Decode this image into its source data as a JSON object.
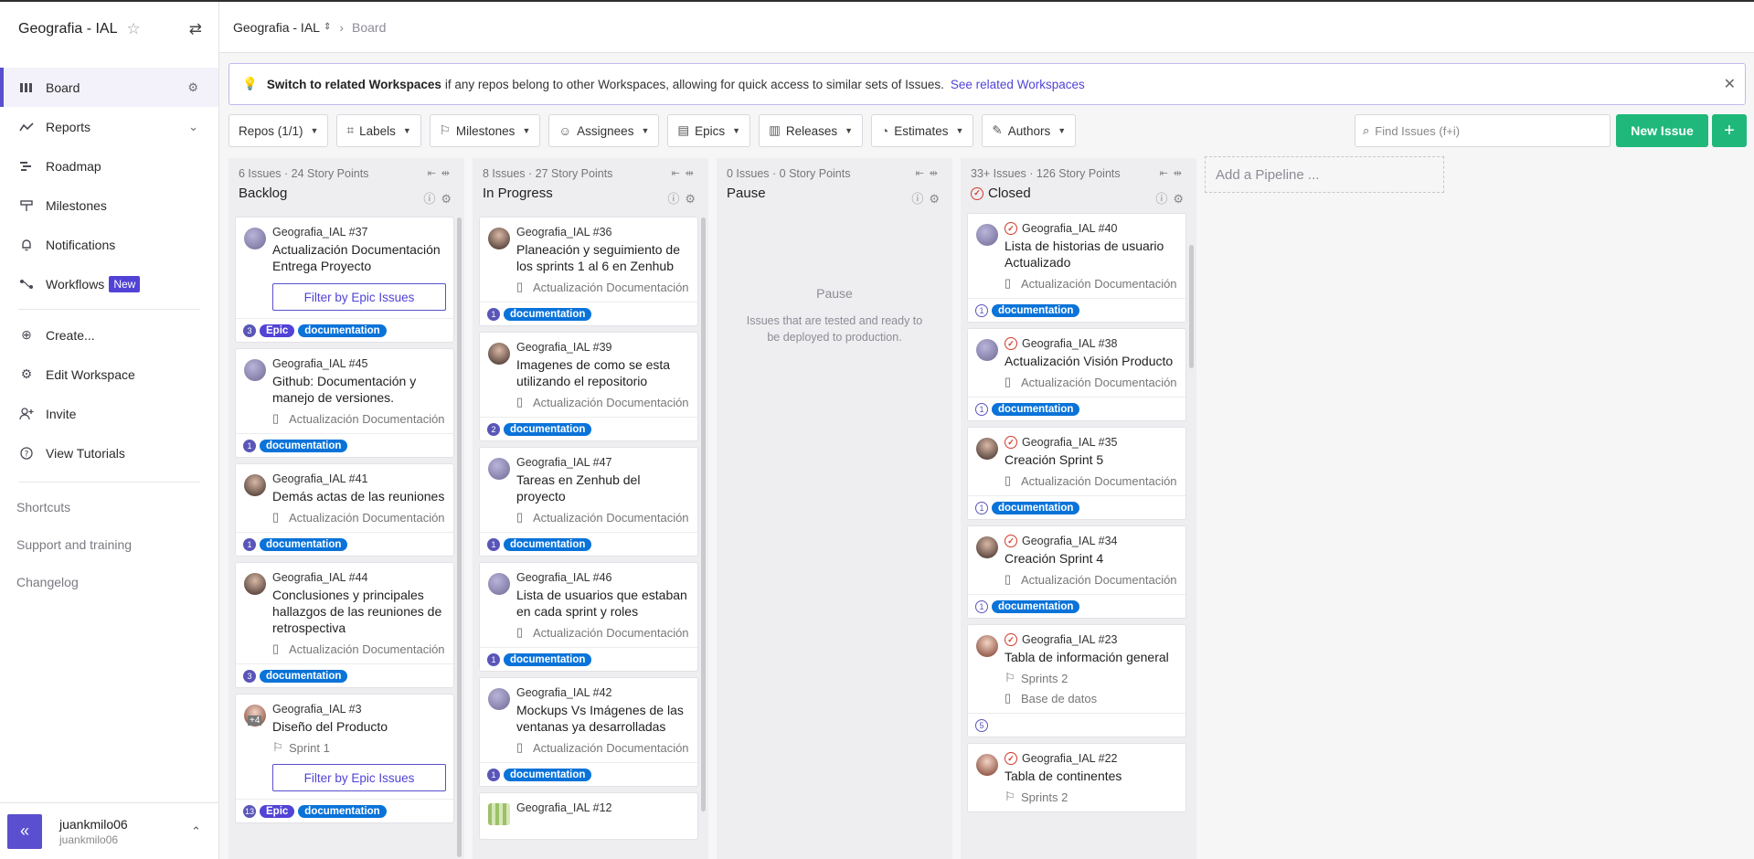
{
  "sidebar": {
    "workspace": "Geografia - IAL",
    "nav": [
      {
        "label": "Board",
        "icon": "board-icon"
      },
      {
        "label": "Reports",
        "icon": "reports-icon"
      },
      {
        "label": "Roadmap",
        "icon": "roadmap-icon"
      },
      {
        "label": "Milestones",
        "icon": "milestone-icon"
      },
      {
        "label": "Notifications",
        "icon": "bell-icon"
      },
      {
        "label": "Workflows",
        "icon": "workflow-icon",
        "badge": "New"
      }
    ],
    "actions": [
      "Create...",
      "Edit Workspace",
      "Invite",
      "View Tutorials"
    ],
    "minor": [
      "Shortcuts",
      "Support and training",
      "Changelog"
    ],
    "user": {
      "name": "juankmilo06",
      "handle": "juankmilo06"
    }
  },
  "header": {
    "workspace": "Geografia - IAL",
    "page": "Board"
  },
  "banner": {
    "lead": "Switch to related Workspaces",
    "text": "if any repos belong to other Workspaces, allowing for quick access to similar sets of Issues.",
    "link": "See related Workspaces"
  },
  "toolbar": {
    "repos": "Repos (1/1)",
    "labels": "Labels",
    "milestones": "Milestones",
    "assignees": "Assignees",
    "epics": "Epics",
    "releases": "Releases",
    "estimates": "Estimates",
    "authors": "Authors",
    "search_placeholder": "Find Issues (f+i)",
    "new_issue": "New Issue",
    "add": "+"
  },
  "pipelines": [
    {
      "name": "Backlog",
      "meta": "6 Issues · 24 Story Points",
      "cards": [
        {
          "repo": "Geografia_IAL #37",
          "title": "Actualización Documentación Entrega Proyecto",
          "filter": "Filter by Epic Issues",
          "est": "3",
          "labels": [
            "Epic",
            "documentation"
          ]
        },
        {
          "repo": "Geografia_IAL #45",
          "title": "Github: Documentación y manejo de versiones.",
          "epic": "Actualización Documentación Ent...",
          "est": "1",
          "labels": [
            "documentation"
          ]
        },
        {
          "repo": "Geografia_IAL #41",
          "title": "Demás actas de las reuniones",
          "epic": "Actualización Documentación Ent...",
          "est": "1",
          "labels": [
            "documentation"
          ]
        },
        {
          "repo": "Geografia_IAL #44",
          "title": "Conclusiones y principales hallazgos de las reuniones de retrospectiva",
          "epic": "Actualización Documentación Ent...",
          "est": "3",
          "labels": [
            "documentation"
          ]
        },
        {
          "repo": "Geografia_IAL #3",
          "title": "Diseño del Producto",
          "milestone": "Sprint 1",
          "filter": "Filter by Epic Issues",
          "avatar_more": "+4",
          "est": "13",
          "labels": [
            "Epic",
            "documentation"
          ]
        }
      ]
    },
    {
      "name": "In Progress",
      "meta": "8 Issues · 27 Story Points",
      "cards": [
        {
          "repo": "Geografia_IAL #36",
          "title": "Planeación y seguimiento de los sprints 1 al 6 en Zenhub",
          "epic": "Actualización Documentación Ent...",
          "est": "1",
          "labels": [
            "documentation"
          ]
        },
        {
          "repo": "Geografia_IAL #39",
          "title": "Imagenes de como se esta utilizando el repositorio",
          "epic": "Actualización Documentación Ent...",
          "est": "2",
          "labels": [
            "documentation"
          ]
        },
        {
          "repo": "Geografia_IAL #47",
          "title": "Tareas en Zenhub del proyecto",
          "epic": "Actualización Documentación Ent...",
          "est": "1",
          "labels": [
            "documentation"
          ]
        },
        {
          "repo": "Geografia_IAL #46",
          "title": "Lista de usuarios que estaban en cada sprint y roles",
          "epic": "Actualización Documentación Ent...",
          "est": "1",
          "labels": [
            "documentation"
          ]
        },
        {
          "repo": "Geografia_IAL #42",
          "title": "Mockups Vs Imágenes de las ventanas ya desarrolladas",
          "epic": "Actualización Documentación Ent...",
          "est": "1",
          "labels": [
            "documentation"
          ]
        },
        {
          "repo": "Geografia_IAL #12",
          "title": ""
        }
      ]
    },
    {
      "name": "Pause",
      "meta": "0 Issues · 0 Story Points",
      "empty_title": "Pause",
      "empty_text": "Issues that are tested and ready to be deployed to production."
    },
    {
      "name": "Closed",
      "meta": "33+ Issues · 126 Story Points",
      "cards": [
        {
          "repo": "Geografia_IAL #40",
          "title": "Lista de historias de usuario Actualizado",
          "epic": "Actualización Documentación Ent...",
          "est": "1",
          "labels": [
            "documentation"
          ]
        },
        {
          "repo": "Geografia_IAL #38",
          "title": "Actualización Visión Producto",
          "epic": "Actualización Documentación Ent...",
          "est": "1",
          "labels": [
            "documentation"
          ]
        },
        {
          "repo": "Geografia_IAL #35",
          "title": "Creación Sprint 5",
          "epic": "Actualización Documentación Ent...",
          "est": "1",
          "labels": [
            "documentation"
          ]
        },
        {
          "repo": "Geografia_IAL #34",
          "title": "Creación Sprint 4",
          "epic": "Actualización Documentación Ent...",
          "est": "1",
          "labels": [
            "documentation"
          ]
        },
        {
          "repo": "Geografia_IAL #23",
          "title": "Tabla de información general",
          "milestone": "Sprints 2",
          "epic": "Base de datos",
          "est": "5"
        },
        {
          "repo": "Geografia_IAL #22",
          "title": "Tabla de continentes",
          "milestone": "Sprints 2"
        }
      ]
    }
  ],
  "add_pipeline": "Add a Pipeline ..."
}
